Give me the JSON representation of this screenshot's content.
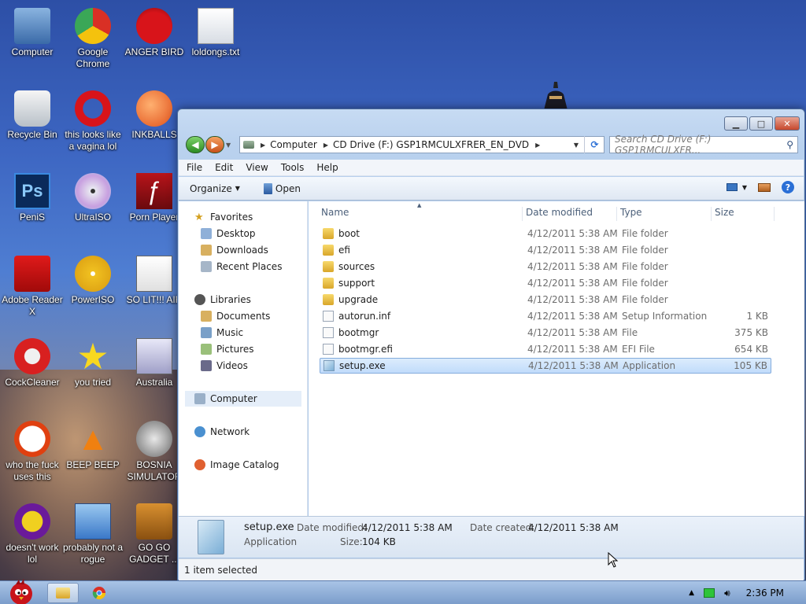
{
  "desktop": {
    "icons": [
      {
        "label": "Computer",
        "icon": "computer-icon"
      },
      {
        "label": "Google Chrome",
        "icon": "chrome-icon"
      },
      {
        "label": "ANGER BIRD",
        "icon": "angry-bird-icon"
      },
      {
        "label": "loldongs.txt",
        "icon": "text-file-icon"
      },
      {
        "label": "Recycle Bin",
        "icon": "recycle-bin-icon"
      },
      {
        "label": "this looks like a vagina lol",
        "icon": "opera-icon"
      },
      {
        "label": "INKBALLS",
        "icon": "inkball-icon"
      },
      {
        "label": "PeniS",
        "icon": "photoshop-icon"
      },
      {
        "label": "UltraISO",
        "icon": "disc-icon"
      },
      {
        "label": "Porn Player",
        "icon": "flash-icon"
      },
      {
        "label": "Adobe Reader X",
        "icon": "adobe-reader-icon"
      },
      {
        "label": "PowerISO",
        "icon": "poweriso-icon"
      },
      {
        "label": "SO LIT!!! AIR",
        "icon": "cards-icon"
      },
      {
        "label": "CockCleaner",
        "icon": "ccleaner-icon"
      },
      {
        "label": "you tried",
        "icon": "star-icon"
      },
      {
        "label": "Australia",
        "icon": "spider-icon"
      },
      {
        "label": "who the fuck uses this",
        "icon": "lightning-icon"
      },
      {
        "label": "BEEP BEEP",
        "icon": "vlc-icon"
      },
      {
        "label": "BOSNIA SIMULATOR",
        "icon": "gear-ball-icon"
      },
      {
        "label": "doesn't work lol",
        "icon": "yahoo-icon"
      },
      {
        "label": "probably not a rogue",
        "icon": "control-panel-icon"
      },
      {
        "label": "GO GO GADGET ...",
        "icon": "briefcase-icon"
      }
    ]
  },
  "explorer": {
    "caption": {
      "minimize": "▁",
      "maximize": "□",
      "close": "✕"
    },
    "breadcrumb": [
      "Computer",
      "CD Drive (F:) GSP1RMCULXFRER_EN_DVD"
    ],
    "search_placeholder": "Search CD Drive (F:) GSP1RMCULXFR...",
    "menu": [
      "File",
      "Edit",
      "View",
      "Tools",
      "Help"
    ],
    "toolbar": {
      "organize": "Organize",
      "open": "Open"
    },
    "nav_pane": {
      "favorites": "Favorites",
      "favorites_items": [
        "Desktop",
        "Downloads",
        "Recent Places"
      ],
      "libraries": "Libraries",
      "libraries_items": [
        "Documents",
        "Music",
        "Pictures",
        "Videos"
      ],
      "computer": "Computer",
      "network": "Network",
      "image_catalog": "Image Catalog"
    },
    "columns": [
      "Name",
      "Date modified",
      "Type",
      "Size"
    ],
    "files": [
      {
        "name": "boot",
        "date": "4/12/2011 5:38 AM",
        "type": "File folder",
        "size": "",
        "kind": "folder"
      },
      {
        "name": "efi",
        "date": "4/12/2011 5:38 AM",
        "type": "File folder",
        "size": "",
        "kind": "folder"
      },
      {
        "name": "sources",
        "date": "4/12/2011 5:38 AM",
        "type": "File folder",
        "size": "",
        "kind": "folder"
      },
      {
        "name": "support",
        "date": "4/12/2011 5:38 AM",
        "type": "File folder",
        "size": "",
        "kind": "folder"
      },
      {
        "name": "upgrade",
        "date": "4/12/2011 5:38 AM",
        "type": "File folder",
        "size": "",
        "kind": "folder"
      },
      {
        "name": "autorun.inf",
        "date": "4/12/2011 5:38 AM",
        "type": "Setup Information",
        "size": "1 KB",
        "kind": "file"
      },
      {
        "name": "bootmgr",
        "date": "4/12/2011 5:38 AM",
        "type": "File",
        "size": "375 KB",
        "kind": "file"
      },
      {
        "name": "bootmgr.efi",
        "date": "4/12/2011 5:38 AM",
        "type": "EFI File",
        "size": "654 KB",
        "kind": "file"
      },
      {
        "name": "setup.exe",
        "date": "4/12/2011 5:38 AM",
        "type": "Application",
        "size": "105 KB",
        "kind": "app",
        "selected": true
      }
    ],
    "details": {
      "name": "setup.exe",
      "type": "Application",
      "date_modified_label": "Date modified:",
      "date_modified": "4/12/2011 5:38 AM",
      "size_label": "Size:",
      "size": "104 KB",
      "date_created_label": "Date created:",
      "date_created": "4/12/2011 5:38 AM"
    },
    "status": "1 item selected"
  },
  "taskbar": {
    "clock": "2:36 PM"
  }
}
